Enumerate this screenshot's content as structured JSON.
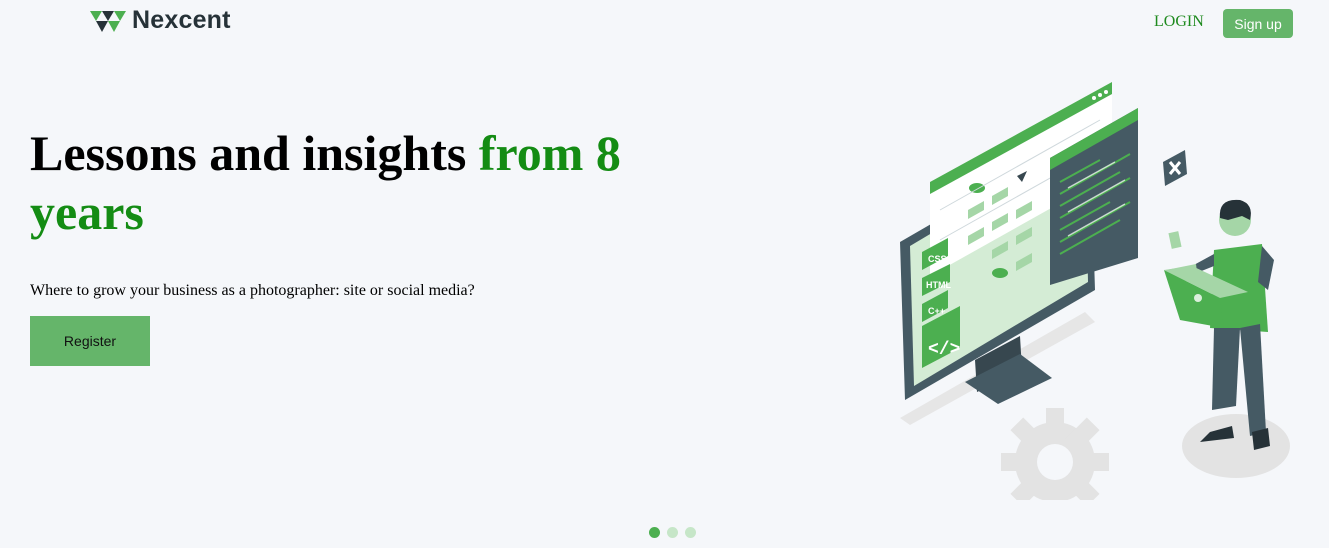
{
  "header": {
    "logo_text": "Nexcent",
    "login_label": "LOGIN",
    "signup_label": "Sign up"
  },
  "hero": {
    "headline_part1": "Lessons and insights ",
    "headline_accent": "from 8 years",
    "subtitle": "Where to grow your business as a photographer: site or social media?",
    "register_label": "Register",
    "illustration": {
      "tag_css": "CSS",
      "tag_html": "HTML",
      "tag_cpp": "C++",
      "code_icon": "</>"
    }
  },
  "carousel": {
    "slide_count": 3,
    "active_index": 0
  },
  "colors": {
    "brand_green": "#4caf50",
    "button_green": "#65b56a",
    "headline_accent": "#148c14",
    "login_text": "#1e8a1e",
    "background": "#f5f7fa",
    "dark": "#263238"
  }
}
